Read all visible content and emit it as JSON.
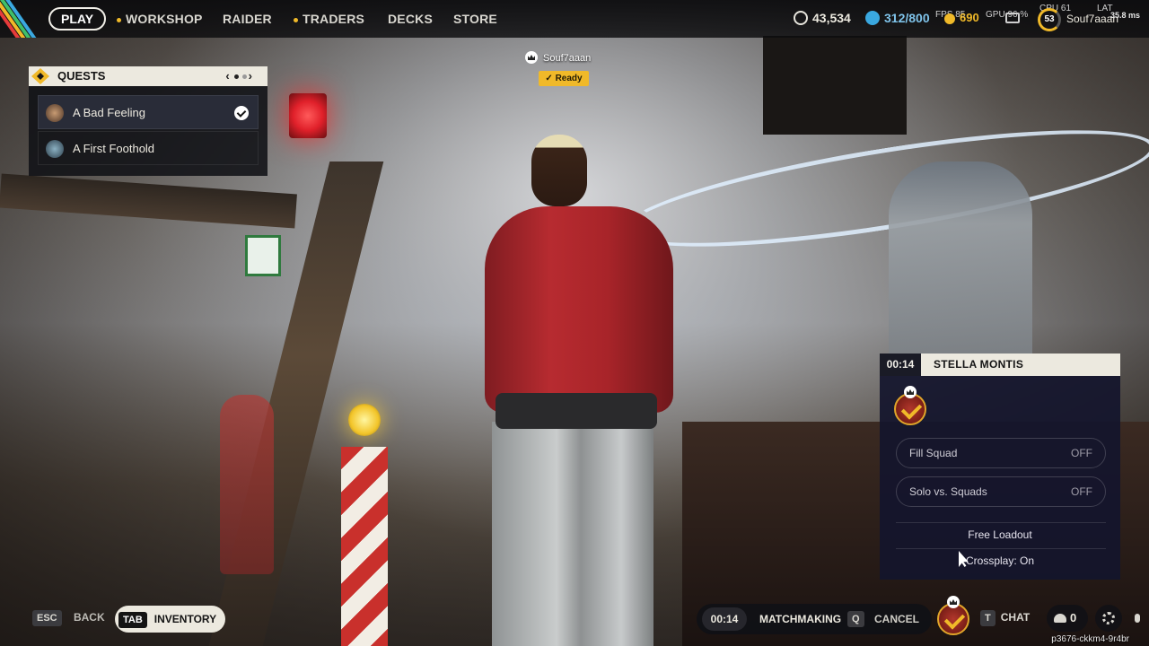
{
  "nav": {
    "play": "PLAY",
    "items": [
      "WORKSHOP",
      "RAIDER",
      "TRADERS",
      "DECKS",
      "STORE"
    ]
  },
  "stats": {
    "coins": "43,534",
    "tokens": "312/800",
    "fps_label": "FPS",
    "fps": "85",
    "premium": "690",
    "gpu_label": "GPU",
    "gpu": "96 %",
    "cpu_label": "CPU",
    "cpu": "61",
    "latency_label": "LAT",
    "latency": "35.8 ms",
    "level": "53",
    "username": "Souf7aaan"
  },
  "quests": {
    "title": "QUESTS",
    "items": [
      {
        "label": "A Bad Feeling",
        "completed": true
      },
      {
        "label": "A First Foothold",
        "completed": false
      }
    ]
  },
  "player": {
    "name": "Souf7aaan",
    "status": "Ready"
  },
  "squad_panel": {
    "timer": "00:14",
    "name": "STELLA MONTIS",
    "fill_squad": {
      "label": "Fill Squad",
      "value": "OFF"
    },
    "solo_vs_squads": {
      "label": "Solo vs. Squads",
      "value": "OFF"
    },
    "loadout": "Free Loadout",
    "crossplay": "Crossplay: On"
  },
  "bottom": {
    "esc_key": "ESC",
    "back": "BACK",
    "tab_key": "TAB",
    "inventory": "INVENTORY",
    "mm_timer": "00:14",
    "matchmaking": "MATCHMAKING",
    "cancel_key": "Q",
    "cancel": "CANCEL",
    "chat_key": "T",
    "chat": "CHAT",
    "friends_count": "0",
    "build_id": "p3676-ckkm4-9r4br"
  },
  "colors": {
    "accent": "#f0b929",
    "panel_bg": "#14152c",
    "cream": "#ece9df",
    "red": "#b72b30"
  },
  "icons": [
    "search-icon",
    "coin-icon",
    "token-icon",
    "premium-icon",
    "mail-icon",
    "check-icon",
    "crown-icon",
    "gear-icon",
    "friends-icon",
    "mic-icon"
  ]
}
